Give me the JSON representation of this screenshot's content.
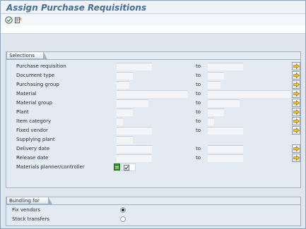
{
  "window": {
    "title": "Assign Purchase Requisitions"
  },
  "toolbar": {
    "execute_icon": "execute-icon",
    "variant_icon": "get-variant-icon"
  },
  "selections": {
    "title": "Selections",
    "to_label": "to",
    "rows": [
      {
        "label": "Purchase requisition",
        "from": "",
        "to": "",
        "has_to": true,
        "has_multi": true
      },
      {
        "label": "Document type",
        "from": "",
        "to": "",
        "has_to": true,
        "has_multi": true
      },
      {
        "label": "Purchasing group",
        "from": "",
        "to": "",
        "has_to": true,
        "has_multi": true
      },
      {
        "label": "Material",
        "from": "",
        "to": "",
        "has_to": true,
        "has_multi": true
      },
      {
        "label": "Material group",
        "from": "",
        "to": "",
        "has_to": true,
        "has_multi": true
      },
      {
        "label": "Plant",
        "from": "",
        "to": "",
        "has_to": true,
        "has_multi": true
      },
      {
        "label": "Item category",
        "from": "",
        "to": "",
        "has_to": true,
        "has_multi": true
      },
      {
        "label": "Fixed vendor",
        "from": "",
        "to": "",
        "has_to": true,
        "has_multi": true
      },
      {
        "label": "Supplying plant",
        "from": "",
        "has_to": false,
        "has_multi": false
      },
      {
        "label": "Delivery date",
        "from": "",
        "to": "",
        "has_to": true,
        "has_multi": true
      },
      {
        "label": "Release date",
        "from": "",
        "to": "",
        "has_to": true,
        "has_multi": true
      },
      {
        "label": "Materials planner/controller",
        "checked": true,
        "has_to": false,
        "has_multi": false
      }
    ]
  },
  "bundling": {
    "title": "Bundling for",
    "options": [
      {
        "label": "Fix vendors",
        "selected": true
      },
      {
        "label": "Stock transfers",
        "selected": false
      }
    ]
  },
  "colors": {
    "title_text": "#4a6e93",
    "section_bg": "#e4eaf1",
    "field_bg": "#f3f5f8",
    "arrow_yellow": "#f2c21b",
    "green_button": "#2f9e2f"
  }
}
